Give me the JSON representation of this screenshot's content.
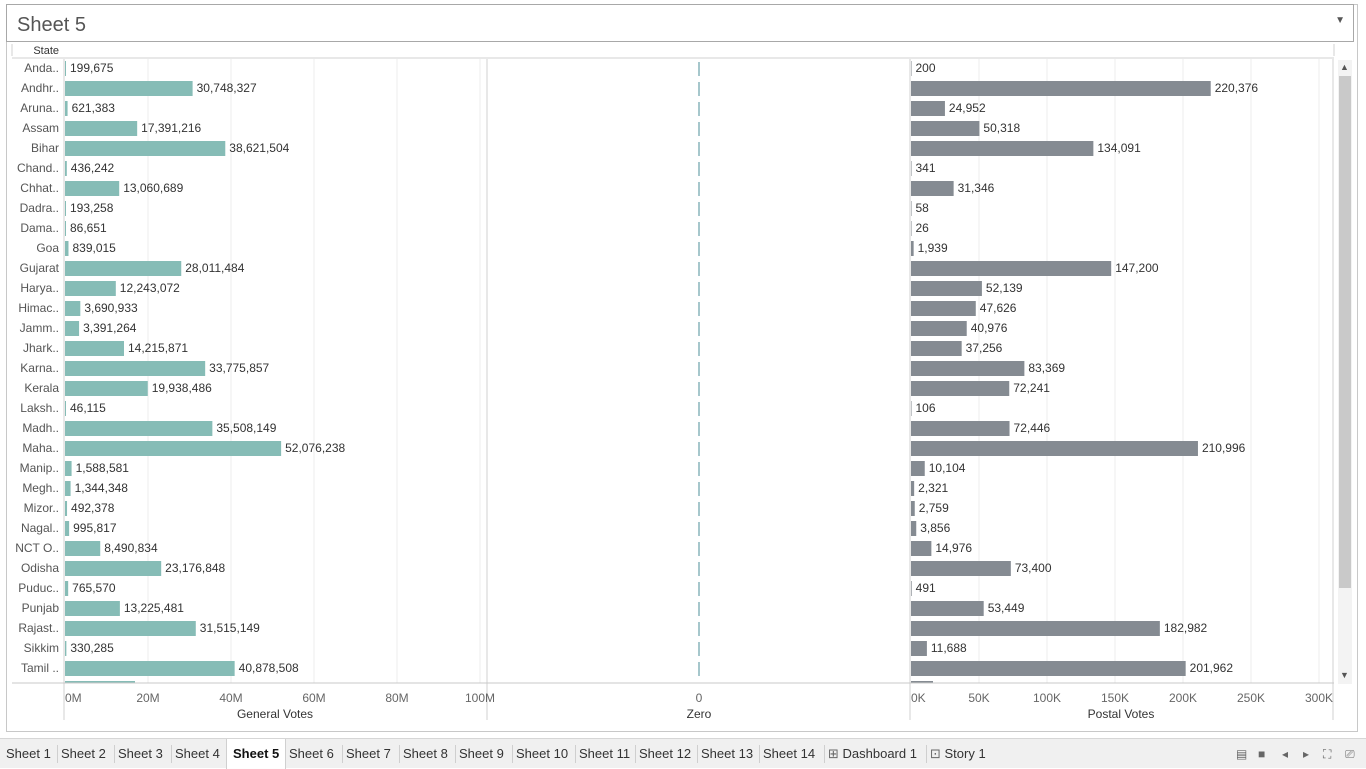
{
  "title": "Sheet 5",
  "row_header": "State",
  "axes": {
    "general_title": "General Votes",
    "zero_title": "Zero",
    "postal_title": "Postal Votes",
    "general_ticks": [
      "0M",
      "20M",
      "40M",
      "60M",
      "80M",
      "100M"
    ],
    "zero_ticks": [
      "0"
    ],
    "postal_ticks": [
      "0K",
      "50K",
      "100K",
      "150K",
      "200K",
      "250K",
      "300K"
    ]
  },
  "colors": {
    "general": "#86bcb6",
    "postal": "#858b92",
    "zero_line": "#4e8f9a"
  },
  "chart_data": {
    "type": "bar",
    "categories": [
      "Anda..",
      "Andhr..",
      "Aruna..",
      "Assam",
      "Bihar",
      "Chand..",
      "Chhat..",
      "Dadra..",
      "Dama..",
      "Goa",
      "Gujarat",
      "Harya..",
      "Himac..",
      "Jamm..",
      "Jhark..",
      "Karna..",
      "Kerala",
      "Laksh..",
      "Madh..",
      "Maha..",
      "Manip..",
      "Megh..",
      "Mizor..",
      "Nagal..",
      "NCT O..",
      "Odisha",
      "Puduc..",
      "Punjab",
      "Rajast..",
      "Sikkim",
      "Tamil .."
    ],
    "series": [
      {
        "name": "General Votes",
        "values": [
          199675,
          30748327,
          621383,
          17391216,
          38621504,
          436242,
          13060689,
          193258,
          86651,
          839015,
          28011484,
          12243072,
          3690933,
          3391264,
          14215871,
          33775857,
          19938486,
          46115,
          35508149,
          52076238,
          1588581,
          1344348,
          492378,
          995817,
          8490834,
          23176848,
          765570,
          13225481,
          31515149,
          330285,
          40878508
        ],
        "labels": [
          "199,675",
          "30,748,327",
          "621,383",
          "17,391,216",
          "38,621,504",
          "436,242",
          "13,060,689",
          "193,258",
          "86,651",
          "839,015",
          "28,011,484",
          "12,243,072",
          "3,690,933",
          "3,391,264",
          "14,215,871",
          "33,775,857",
          "19,938,486",
          "46,115",
          "35,508,149",
          "52,076,238",
          "1,588,581",
          "1,344,348",
          "492,378",
          "995,817",
          "8,490,834",
          "23,176,848",
          "765,570",
          "13,225,481",
          "31,515,149",
          "330,285",
          "40,878,508"
        ]
      },
      {
        "name": "Postal Votes",
        "values": [
          200,
          220376,
          24952,
          50318,
          134091,
          341,
          31346,
          58,
          26,
          1939,
          147200,
          52139,
          47626,
          40976,
          37256,
          83369,
          72241,
          106,
          72446,
          210996,
          10104,
          2321,
          2759,
          3856,
          14976,
          73400,
          491,
          53449,
          182982,
          11688,
          201962
        ],
        "labels": [
          "200",
          "220,376",
          "24,952",
          "50,318",
          "134,091",
          "341",
          "31,346",
          "58",
          "26",
          "1,939",
          "147,200",
          "52,139",
          "47,626",
          "40,976",
          "37,256",
          "83,369",
          "72,241",
          "106",
          "72,446",
          "210,996",
          "10,104",
          "2,321",
          "2,759",
          "3,856",
          "14,976",
          "73,400",
          "491",
          "53,449",
          "182,982",
          "11,688",
          "201,962"
        ]
      }
    ],
    "xlim_general": [
      0,
      100000000
    ],
    "xlim_postal": [
      0,
      300000
    ],
    "grid": true
  },
  "tabs": [
    "Sheet 1",
    "Sheet 2",
    "Sheet 3",
    "Sheet 4",
    "Sheet 5",
    "Sheet 6",
    "Sheet 7",
    "Sheet 8",
    "Sheet 9",
    "Sheet 10",
    "Sheet 11",
    "Sheet 12",
    "Sheet 13",
    "Sheet 14",
    "Dashboard 1",
    "Story 1"
  ],
  "active_tab": "Sheet 5",
  "tab_icons": {
    "Dashboard 1": "grid-icon",
    "Story 1": "book-icon"
  },
  "controls": [
    "grid-view-icon",
    "list-view-icon",
    "prev-icon",
    "next-icon",
    "fullscreen-icon",
    "present-icon"
  ]
}
